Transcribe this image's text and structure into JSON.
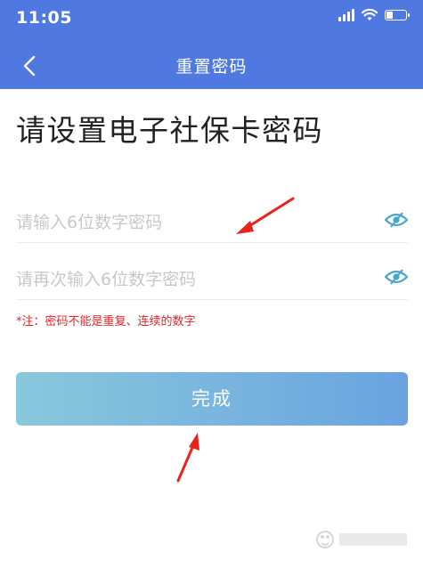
{
  "status_bar": {
    "time": "11:05"
  },
  "nav": {
    "title": "重置密码",
    "back_icon": "chevron-left-icon"
  },
  "page": {
    "title": "请设置电子社保卡密码"
  },
  "fields": [
    {
      "placeholder": "请输入6位数字密码",
      "value": "",
      "icon": "eye-icon"
    },
    {
      "placeholder": "请再次输入6位数字密码",
      "value": "",
      "icon": "eye-icon"
    }
  ],
  "note": "*注：密码不能是重复、连续的数字",
  "done_button": {
    "label": "完成"
  },
  "colors": {
    "header_bg": "#4f79e0",
    "note": "#e22424",
    "button_gradient_start": "#89c8dc",
    "button_gradient_end": "#6aa3e0",
    "eye_icon": "#4aa6c9",
    "annotation_arrow": "#e8231d"
  }
}
